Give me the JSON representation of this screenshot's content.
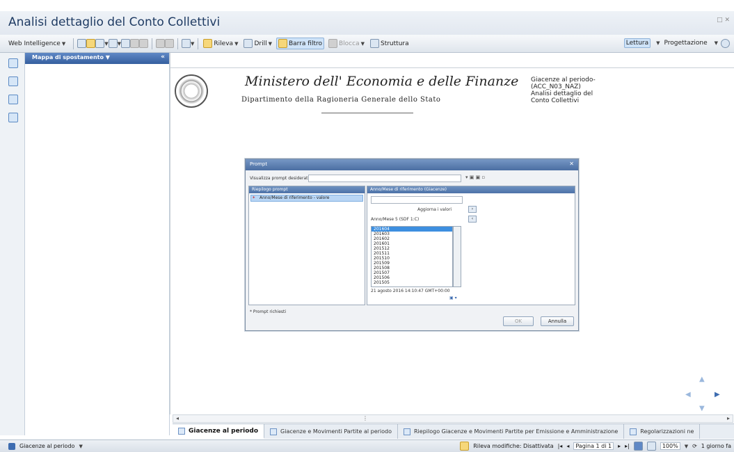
{
  "window": {
    "title": "Analisi dettaglio del Conto Collettivi",
    "controls": "□ ✕"
  },
  "toolbar": {
    "web_intelligence": "Web Intelligence",
    "rileva": "Rileva",
    "drill": "Drill",
    "barra_filtro": "Barra filtro",
    "blocca": "Blocca",
    "struttura": "Struttura",
    "lettura": "Lettura",
    "progettazione": "Progettazione"
  },
  "panel": {
    "title": "Mappa di spostamento"
  },
  "report": {
    "ministry": "Ministero dell' Economia e delle Finanze",
    "department": "Dipartimento della Ragioneria Generale dello Stato",
    "info": [
      "Giacenze al periodo-",
      "(ACC_N03_NAZ)",
      "Analisi dettaglio del",
      "Conto Collettivi"
    ]
  },
  "dialog": {
    "title": "Prompt",
    "list_label": "Visualizza prompt desiderati:",
    "left_title": "Riepilogo prompt",
    "selected_prompt": "Anno/Mese di riferimento - valore",
    "right_title": "Anno/Mese di riferimento (Giacenze)",
    "refresh": "Aggiorna i valori",
    "field_label": "Anno/Mese 5 (SDF 1:C)",
    "values": [
      "201604",
      "201603",
      "201602",
      "201601",
      "201512",
      "201511",
      "201510",
      "201509",
      "201508",
      "201507",
      "201506",
      "201505"
    ],
    "timestamp": "21 agosto 2016 14:10:47 GMT+00:00",
    "footer_note": "* Prompt richiesti",
    "ok": "OK",
    "cancel": "Annulla"
  },
  "tabs": [
    {
      "label": "Giacenze al periodo"
    },
    {
      "label": "Giacenze e Movimenti Partite al periodo"
    },
    {
      "label": "Riepilogo Giacenze e Movimenti Partite per Emissione e Amministrazione"
    },
    {
      "label": "Regolarizzazioni ne"
    }
  ],
  "status": {
    "report_name": "Giacenze al periodo",
    "rileva_modifiche": "Rileva modifiche: Disattivata",
    "page": "Pagina 1 di 1",
    "zoom": "100%",
    "refresh_info": "1 giorno fa"
  }
}
